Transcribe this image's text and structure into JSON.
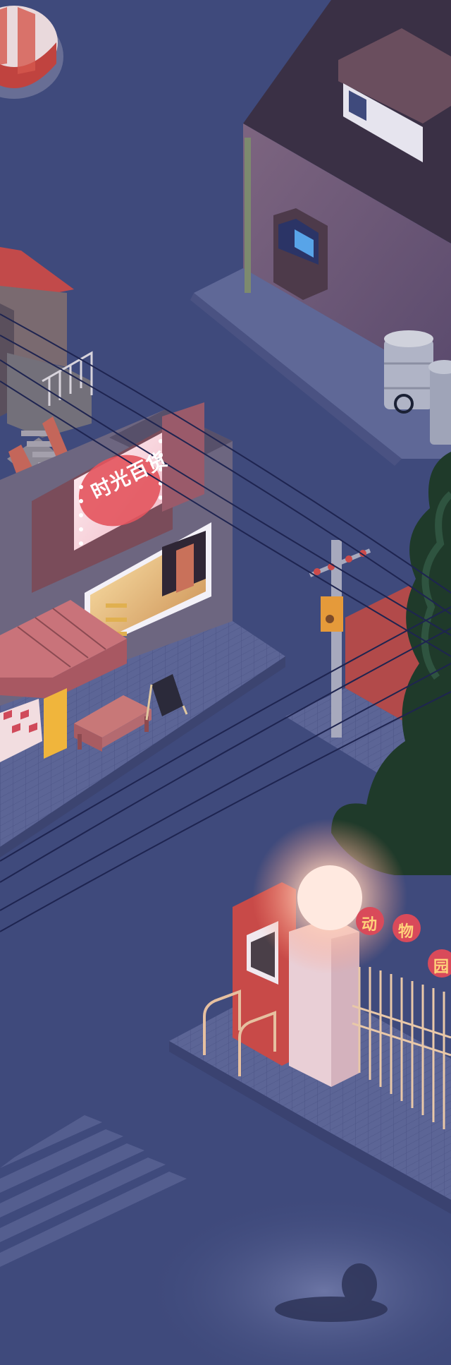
{
  "scene": {
    "shop_sign": "时光百货",
    "zoo_sign_chars": [
      "动",
      "物",
      "园"
    ],
    "colors": {
      "sky": "#3f4a7c",
      "street": "#47528a",
      "sidewalk": "#5a6394",
      "building_purple": "#6f5a78",
      "roof_dark": "#3a3045",
      "awning_pink": "#c9737a",
      "sign_red": "#e3545d",
      "lamp_glow": "#ffd9c8",
      "tree_dark": "#1f3a2a"
    },
    "icons": [
      "atm-icon",
      "lamp-icon",
      "tree-icon",
      "barrel-icon",
      "utility-pole-icon",
      "bench-icon",
      "menu-board-icon"
    ]
  }
}
